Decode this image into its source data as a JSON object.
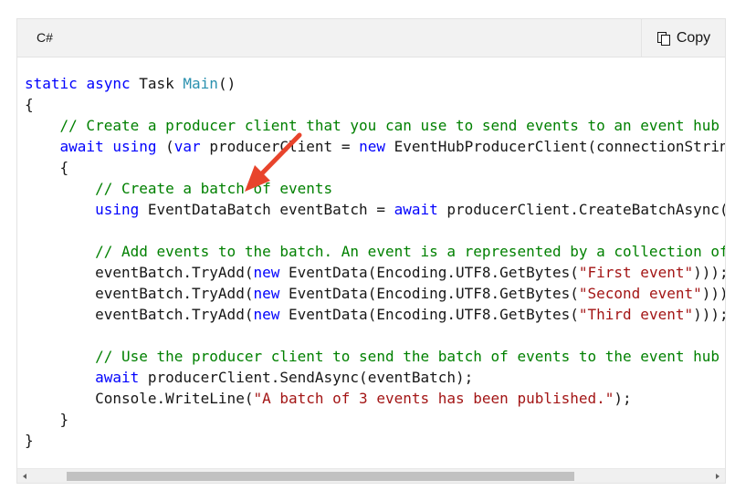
{
  "header": {
    "language": "C#",
    "copy_label": "Copy",
    "copy_icon": "copy-icon"
  },
  "colors": {
    "keyword": "#0101fd",
    "comment": "#008000",
    "string": "#a31515",
    "type": "#2b91af",
    "annotation_arrow": "#e8442c"
  },
  "code": {
    "lines": [
      [
        {
          "t": "static",
          "c": "kw"
        },
        {
          "t": " "
        },
        {
          "t": "async",
          "c": "kw"
        },
        {
          "t": " Task "
        },
        {
          "t": "Main",
          "c": "ty"
        },
        {
          "t": "()"
        }
      ],
      [
        {
          "t": "{"
        }
      ],
      [
        {
          "t": "    "
        },
        {
          "t": "// Create a producer client that you can use to send events to an event hub",
          "c": "cm"
        }
      ],
      [
        {
          "t": "    "
        },
        {
          "t": "await",
          "c": "kw"
        },
        {
          "t": " "
        },
        {
          "t": "using",
          "c": "kw"
        },
        {
          "t": " ("
        },
        {
          "t": "var",
          "c": "kw"
        },
        {
          "t": " producerClient = "
        },
        {
          "t": "new",
          "c": "kw"
        },
        {
          "t": " EventHubProducerClient(connectionString, eventHubName))"
        }
      ],
      [
        {
          "t": "    {"
        }
      ],
      [
        {
          "t": "        "
        },
        {
          "t": "// Create a batch of events",
          "c": "cm"
        }
      ],
      [
        {
          "t": "        "
        },
        {
          "t": "using",
          "c": "kw"
        },
        {
          "t": " EventDataBatch eventBatch = "
        },
        {
          "t": "await",
          "c": "kw"
        },
        {
          "t": " producerClient.CreateBatchAsync();"
        }
      ],
      [
        {
          "t": ""
        }
      ],
      [
        {
          "t": "        "
        },
        {
          "t": "// Add events to the batch. An event is a represented by a collection of bytes and metadata.",
          "c": "cm"
        }
      ],
      [
        {
          "t": "        eventBatch.TryAdd("
        },
        {
          "t": "new",
          "c": "kw"
        },
        {
          "t": " EventData(Encoding.UTF8.GetBytes("
        },
        {
          "t": "\"First event\"",
          "c": "st"
        },
        {
          "t": ")));"
        }
      ],
      [
        {
          "t": "        eventBatch.TryAdd("
        },
        {
          "t": "new",
          "c": "kw"
        },
        {
          "t": " EventData(Encoding.UTF8.GetBytes("
        },
        {
          "t": "\"Second event\"",
          "c": "st"
        },
        {
          "t": ")));"
        }
      ],
      [
        {
          "t": "        eventBatch.TryAdd("
        },
        {
          "t": "new",
          "c": "kw"
        },
        {
          "t": " EventData(Encoding.UTF8.GetBytes("
        },
        {
          "t": "\"Third event\"",
          "c": "st"
        },
        {
          "t": ")));"
        }
      ],
      [
        {
          "t": ""
        }
      ],
      [
        {
          "t": "        "
        },
        {
          "t": "// Use the producer client to send the batch of events to the event hub",
          "c": "cm"
        }
      ],
      [
        {
          "t": "        "
        },
        {
          "t": "await",
          "c": "kw"
        },
        {
          "t": " producerClient.SendAsync(eventBatch);"
        }
      ],
      [
        {
          "t": "        Console.WriteLine("
        },
        {
          "t": "\"A batch of 3 events has been published.\"",
          "c": "st"
        },
        {
          "t": ");"
        }
      ],
      [
        {
          "t": "    }"
        }
      ],
      [
        {
          "t": "}"
        }
      ]
    ]
  },
  "scrollbar": {
    "position_fraction": 0.0,
    "visible_fraction": 0.72
  }
}
